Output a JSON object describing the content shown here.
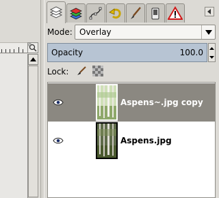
{
  "layers_dialog": {
    "tabs": [
      {
        "icon": "layers-icon",
        "active": true
      },
      {
        "icon": "channels-icon",
        "active": false
      },
      {
        "icon": "paths-icon",
        "active": false
      },
      {
        "icon": "undo-history-icon",
        "active": false
      },
      {
        "icon": "brushes-icon",
        "active": false
      },
      {
        "icon": "device-status-icon",
        "active": false
      },
      {
        "icon": "error-console-icon",
        "active": false
      }
    ],
    "mode_label": "Mode:",
    "mode_value": "Overlay",
    "opacity_label": "Opacity",
    "opacity_value": "100.0",
    "lock_label": "Lock:",
    "layers": [
      {
        "name": "Aspens~.jpg copy",
        "visible": true,
        "selected": true
      },
      {
        "name": "Aspens.jpg",
        "visible": true,
        "selected": false
      }
    ]
  },
  "colors": {
    "selection": "#8b8881",
    "opacity_fill": "#b7c4d3",
    "background": "#dcdad5"
  }
}
